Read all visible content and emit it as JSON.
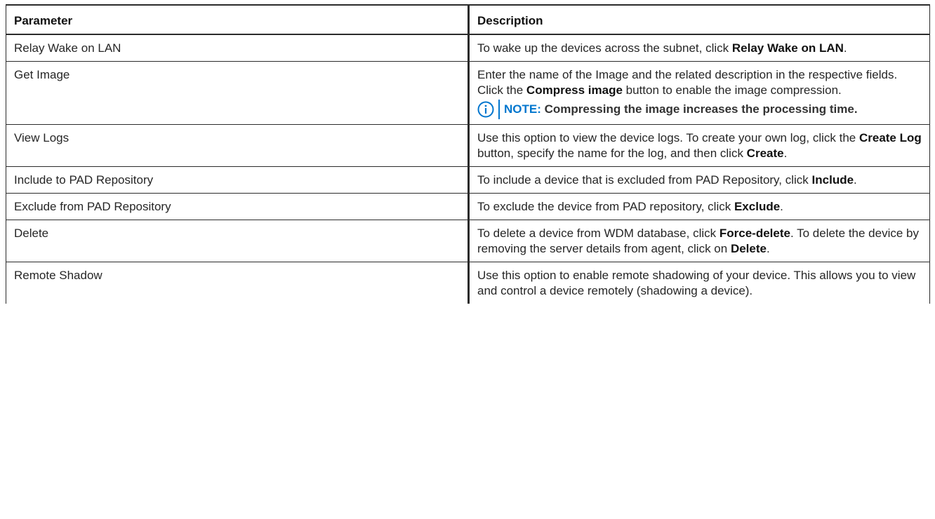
{
  "table": {
    "headers": [
      "Parameter",
      "Description"
    ],
    "rows": [
      {
        "param": "Relay Wake on LAN",
        "desc": [
          {
            "t": "To wake up the devices across the subnet, click "
          },
          {
            "t": "Relay Wake on LAN",
            "b": true
          },
          {
            "t": "."
          }
        ]
      },
      {
        "param": "Get Image",
        "desc": [
          {
            "t": "Enter the name of the Image and the related description in the respective fields. Click the "
          },
          {
            "t": "Compress image",
            "b": true
          },
          {
            "t": " button to enable the image compression."
          }
        ],
        "note": {
          "label": "NOTE:",
          "text": "Compressing the image increases the processing time."
        }
      },
      {
        "param": "View Logs",
        "desc": [
          {
            "t": "Use this option to view the device logs. To create your own log, click the "
          },
          {
            "t": "Create Log",
            "b": true
          },
          {
            "t": " button, specify the name for the log, and then click "
          },
          {
            "t": "Create",
            "b": true
          },
          {
            "t": "."
          }
        ]
      },
      {
        "param": "Include to PAD Repository",
        "desc": [
          {
            "t": "To include a device that is excluded from PAD Repository, click "
          },
          {
            "t": "Include",
            "b": true
          },
          {
            "t": "."
          }
        ]
      },
      {
        "param": "Exclude from PAD Repository",
        "desc": [
          {
            "t": "To exclude the device from PAD repository, click "
          },
          {
            "t": "Exclude",
            "b": true
          },
          {
            "t": "."
          }
        ]
      },
      {
        "param": "Delete",
        "desc": [
          {
            "t": "To delete a device from WDM database, click "
          },
          {
            "t": "Force-delete",
            "b": true
          },
          {
            "t": ". To delete the device by removing the server details from agent, click on "
          },
          {
            "t": "Delete",
            "b": true
          },
          {
            "t": "."
          }
        ]
      },
      {
        "param": "Remote Shadow",
        "desc": [
          {
            "t": "Use this option to enable remote shadowing of your device. This allows you to view and control a device remotely (shadowing a device)."
          }
        ]
      }
    ]
  },
  "colors": {
    "note_accent": "#0076ce",
    "border": "#2b2b2b",
    "text": "#262626"
  },
  "icons": {
    "note": "info-circle-icon"
  }
}
